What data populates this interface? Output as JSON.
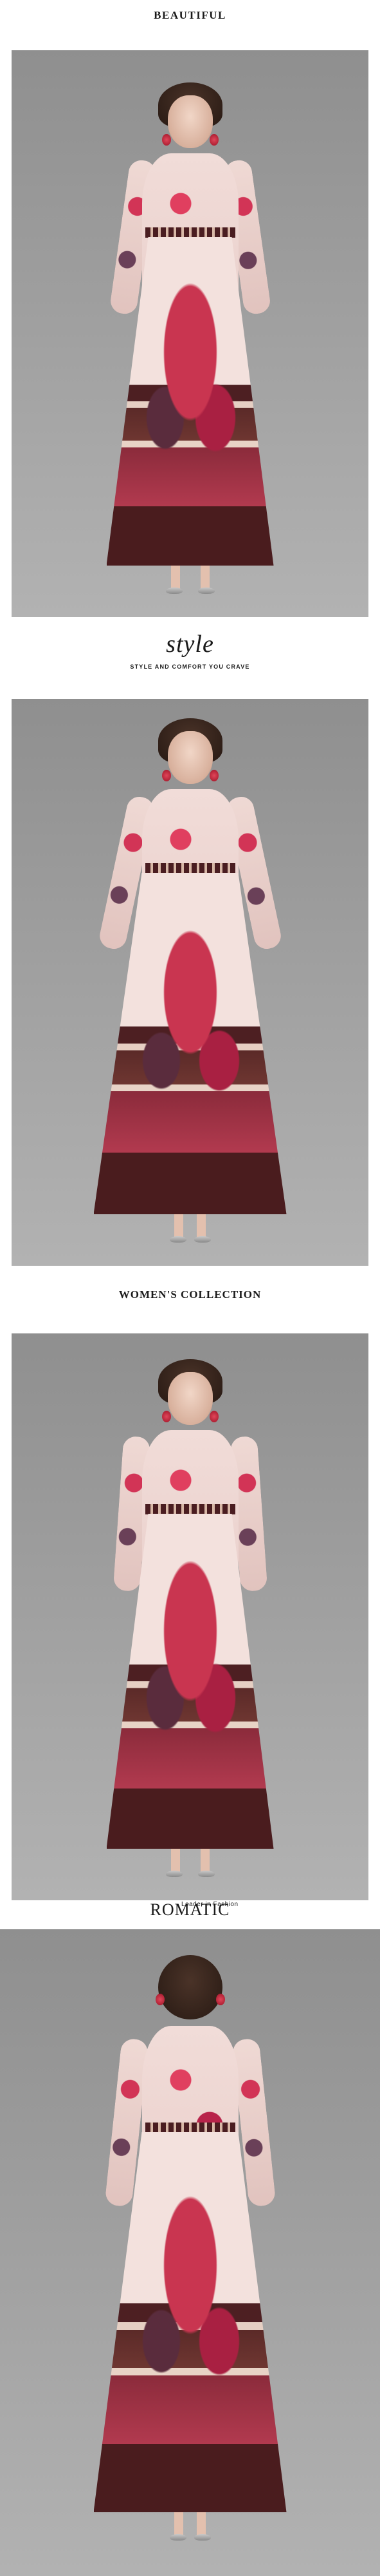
{
  "sections": {
    "beautiful": "BEAUTIFUL",
    "style": "style",
    "style_sub": "STYLE AND COMFORT YOU CRAVE",
    "womens": "WOMEN'S COLLECTION",
    "romatic": "ROMATIC",
    "romatic_small": "Leader in Fashion"
  },
  "photos": [
    {
      "label": "model-front-view-1",
      "pose": "front"
    },
    {
      "label": "model-front-view-2",
      "pose": "front"
    },
    {
      "label": "model-front-view-3",
      "pose": "front"
    },
    {
      "label": "model-back-view",
      "pose": "back"
    }
  ],
  "colors": {
    "background": "#ffffff",
    "photo_bg": "#9d9d9d",
    "accent_red": "#c93550",
    "dark_brown": "#4a1d21",
    "blush": "#f1dcd8"
  }
}
